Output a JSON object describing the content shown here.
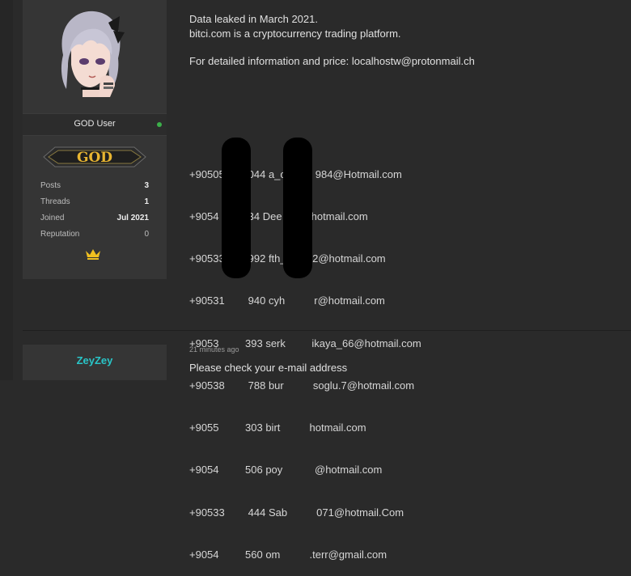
{
  "post1": {
    "user_title": "GOD User",
    "badge_text": "GOD",
    "stats": [
      {
        "label": "Posts",
        "value": "3"
      },
      {
        "label": "Threads",
        "value": "1"
      },
      {
        "label": "Joined",
        "value": "Jul 2021"
      },
      {
        "label": "Reputation",
        "value": "0"
      }
    ],
    "lines": [
      "Data leaked in March 2021.",
      "bitci.com is a cryptocurrency trading platform.",
      "For detailed information and price: localhostw@protonmail.ch"
    ],
    "leak_rows": [
      "+90505        044 a_o          984@Hotmail.com",
      "+9054          34 Dee          hotmail.com",
      "+90533        992 fth_         2@hotmail.com",
      "+90531        940 cyh          r@hotmail.com",
      "+9053         393 serk         ikaya_66@hotmail.com",
      "+90538        788 bur          soglu.7@hotmail.com",
      "+9055         303 birt          hotmail.com",
      "+9054         506 poy           @hotmail.com",
      "+90533        444 Sab          071@hotmail.Com",
      "+9054         560 om          .terr@gmail.com"
    ]
  },
  "post2": {
    "username": "ZeyZey",
    "timestamp": "21 minutes ago",
    "text": "Please check your e-mail address"
  },
  "colors": {
    "online": "#3cb04a",
    "username2": "#29c5c8",
    "badge_gold": "#e8b531",
    "crown": "#f0c020"
  }
}
